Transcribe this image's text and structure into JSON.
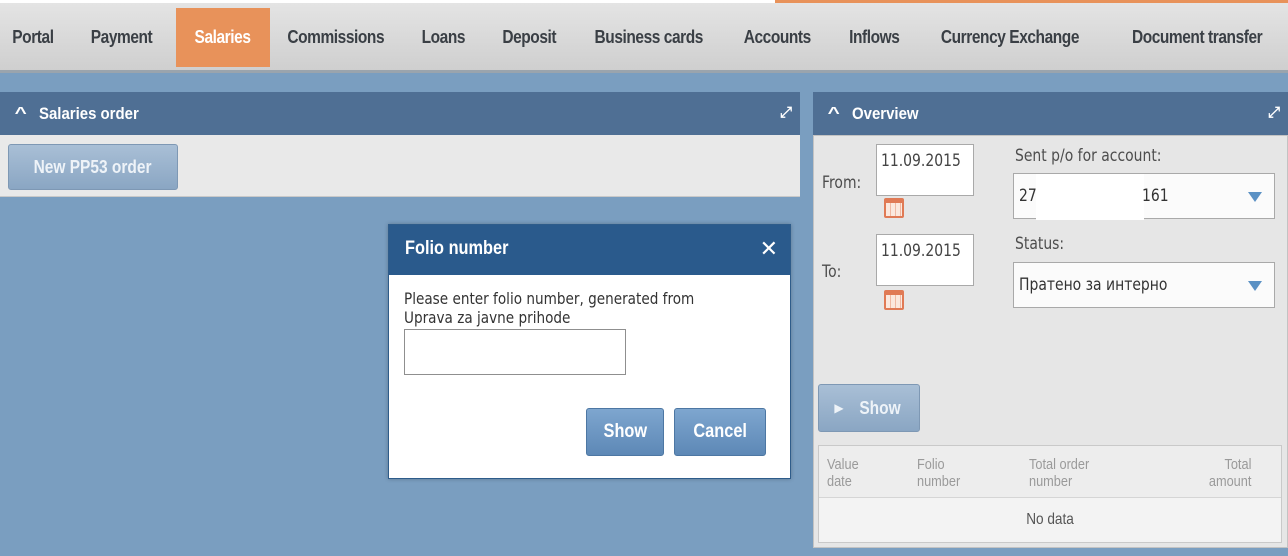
{
  "nav": {
    "items": [
      {
        "label": "Portal"
      },
      {
        "label": "Payment"
      },
      {
        "label": "Salaries"
      },
      {
        "label": "Commissions"
      },
      {
        "label": "Loans"
      },
      {
        "label": "Deposit"
      },
      {
        "label": "Business cards"
      },
      {
        "label": "Accounts"
      },
      {
        "label": "Inflows"
      },
      {
        "label": "Currency Exchange"
      },
      {
        "label": "Document transfer"
      }
    ],
    "active": "Salaries"
  },
  "left_panel": {
    "title": "Salaries order",
    "new_button": "New PP53 order"
  },
  "right_panel": {
    "title": "Overview",
    "from_label": "From:",
    "from_date": "11.09.2015",
    "to_label": "To:",
    "to_date": "11.09.2015",
    "account_label": "Sent p/o for account:",
    "account_prefix": "27",
    "account_suffix": "161",
    "status_label": "Status:",
    "status_value": "Пратено за интерно",
    "show_button": "Show",
    "grid": {
      "columns": [
        "Value date",
        "Folio number",
        "Total order number",
        "Total amount"
      ],
      "empty_text": "No data"
    }
  },
  "modal": {
    "title": "Folio number",
    "message": "Please enter folio number, generated from Uprava za javne prihode",
    "input_value": "",
    "show_button": "Show",
    "cancel_button": "Cancel"
  },
  "colors": {
    "accent": "#e8925a",
    "panel_header": "#4f6f94",
    "modal_header": "#2a5a8c",
    "background": "#7a9ec0"
  }
}
